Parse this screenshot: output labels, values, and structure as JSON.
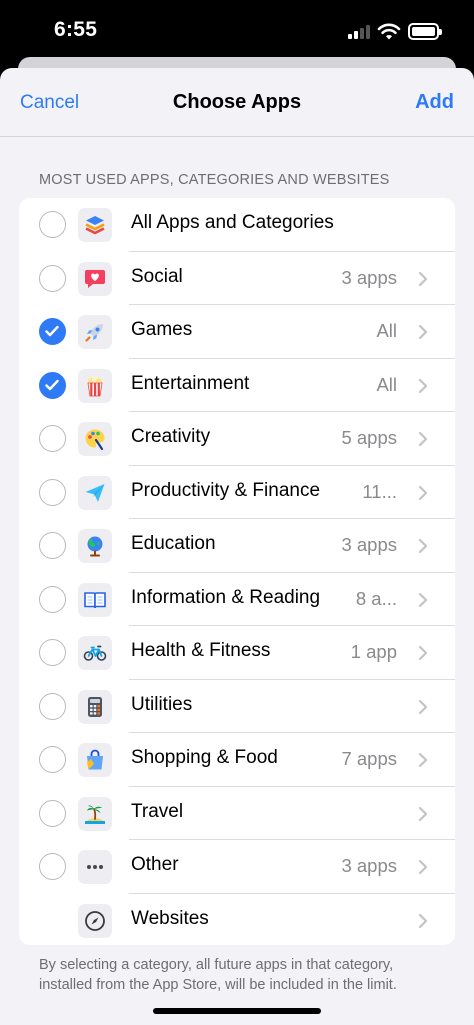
{
  "status_bar": {
    "time": "6:55"
  },
  "nav": {
    "cancel_label": "Cancel",
    "title": "Choose Apps",
    "add_label": "Add"
  },
  "section_header": "MOST USED APPS, CATEGORIES AND WEBSITES",
  "rows": [
    {
      "label": "All Apps and Categories",
      "value": "",
      "checked": false,
      "icon": "stack-icon"
    },
    {
      "label": "Social",
      "value": "3 apps",
      "checked": false,
      "icon": "chat-heart-icon"
    },
    {
      "label": "Games",
      "value": "All",
      "checked": true,
      "icon": "rocket-icon"
    },
    {
      "label": "Entertainment",
      "value": "All",
      "checked": true,
      "icon": "popcorn-icon"
    },
    {
      "label": "Creativity",
      "value": "5 apps",
      "checked": false,
      "icon": "palette-icon"
    },
    {
      "label": "Productivity & Finance",
      "value": "11...",
      "checked": false,
      "icon": "paper-plane-icon"
    },
    {
      "label": "Education",
      "value": "3 apps",
      "checked": false,
      "icon": "globe-icon"
    },
    {
      "label": "Information & Reading",
      "value": "8 a...",
      "checked": false,
      "icon": "book-icon"
    },
    {
      "label": "Health & Fitness",
      "value": "1 app",
      "checked": false,
      "icon": "bicycle-icon"
    },
    {
      "label": "Utilities",
      "value": "",
      "checked": false,
      "icon": "calculator-icon"
    },
    {
      "label": "Shopping & Food",
      "value": "7 apps",
      "checked": false,
      "icon": "shopping-bag-icon"
    },
    {
      "label": "Travel",
      "value": "",
      "checked": false,
      "icon": "island-icon"
    },
    {
      "label": "Other",
      "value": "3 apps",
      "checked": false,
      "icon": "ellipsis-icon"
    },
    {
      "label": "Websites",
      "value": "",
      "checked": false,
      "icon": "compass-icon",
      "no_radio": true
    }
  ],
  "footer_note": "By selecting a category, all future apps in that category, installed from the App Store, will be included in the limit.",
  "colors": {
    "accent": "#2f7af6",
    "background": "#f2f2f7",
    "secondary_text": "#8a8a8e"
  }
}
